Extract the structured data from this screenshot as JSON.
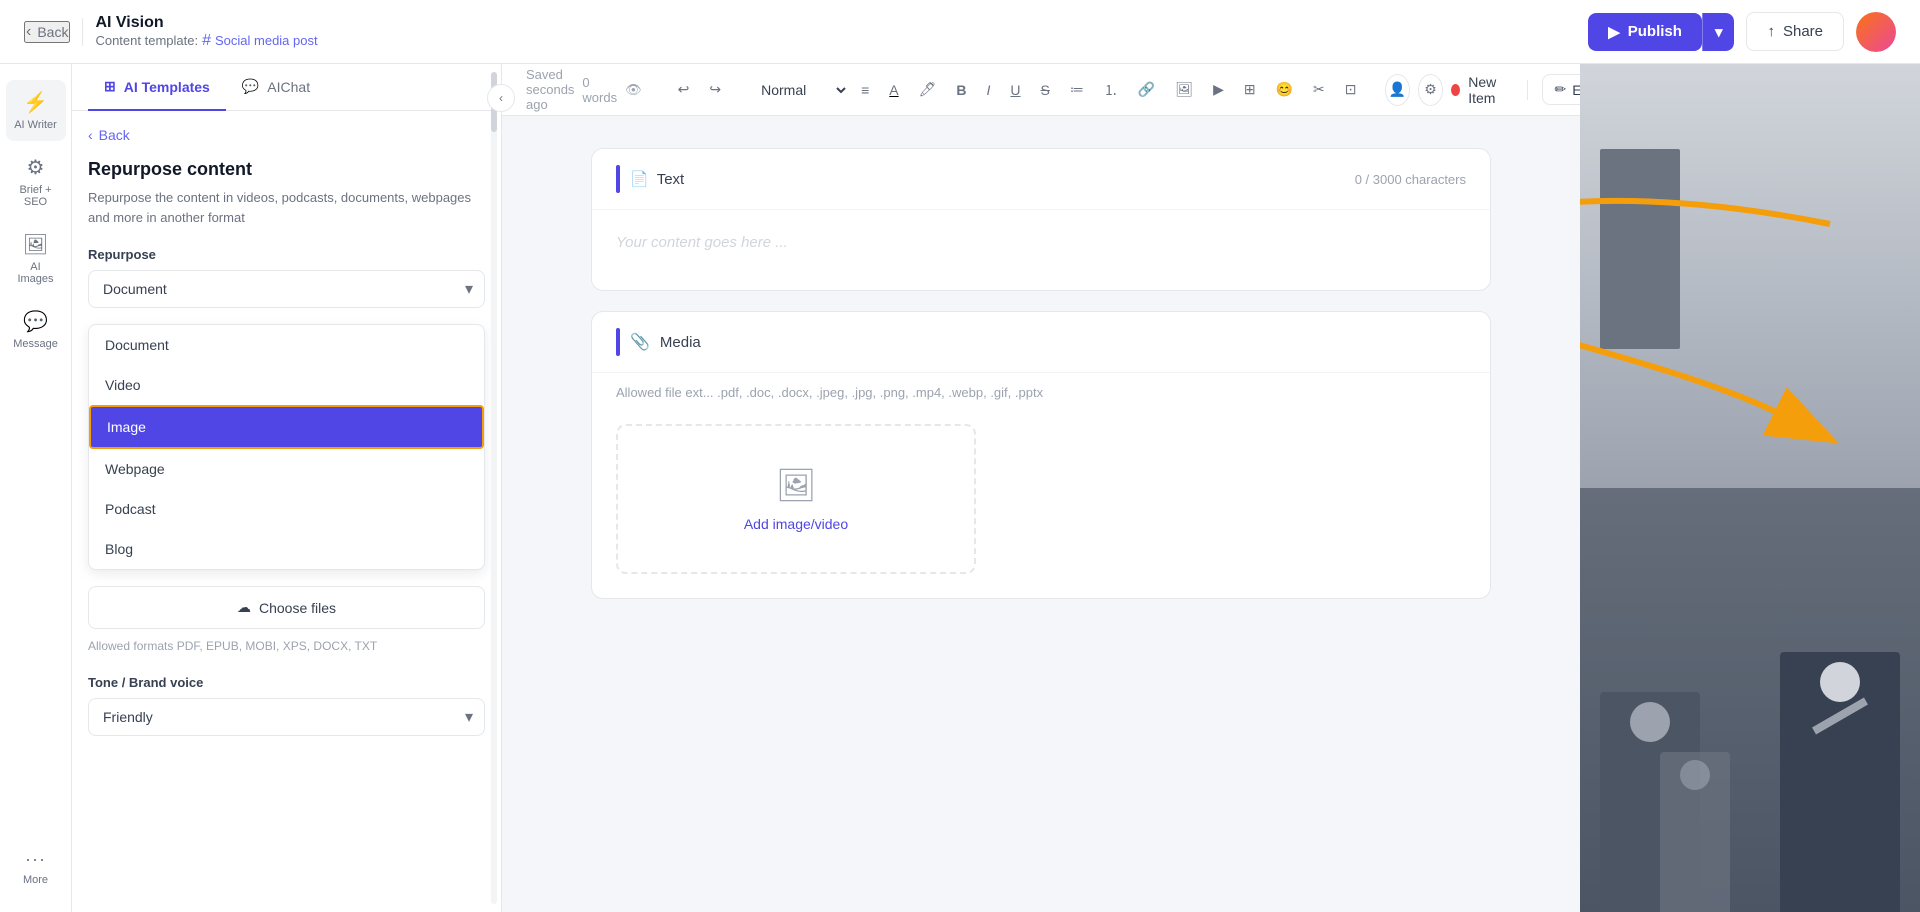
{
  "topbar": {
    "back_label": "Back",
    "app_title": "AI Vision",
    "template_prefix": "Content template:",
    "template_hash": "#",
    "template_name": "Social media post",
    "publish_label": "Publish",
    "share_label": "Share"
  },
  "sidebar": {
    "tabs": [
      {
        "id": "ai-templates",
        "label": "AI Templates",
        "icon": "⊞",
        "active": true
      },
      {
        "id": "aichat",
        "label": "AIChat",
        "icon": "💬",
        "active": false
      }
    ],
    "back_label": "Back",
    "section_title": "Repurpose content",
    "section_desc": "Repurpose the content in videos, podcasts, documents, webpages and more in another format",
    "repurpose_label": "Repurpose",
    "repurpose_value": "Document",
    "dropdown_items": [
      {
        "id": "document",
        "label": "Document",
        "selected": false
      },
      {
        "id": "video",
        "label": "Video",
        "selected": false
      },
      {
        "id": "image",
        "label": "Image",
        "selected": true
      },
      {
        "id": "webpage",
        "label": "Webpage",
        "selected": false
      },
      {
        "id": "podcast",
        "label": "Podcast",
        "selected": false
      },
      {
        "id": "blog",
        "label": "Blog",
        "selected": false
      }
    ],
    "choose_files_label": "Choose files",
    "choose_files_icon": "☁",
    "formats_text": "Allowed formats PDF, EPUB, MOBI, XPS, DOCX, TXT",
    "tone_label": "Tone / Brand voice",
    "tone_value": "Friendly"
  },
  "nav": {
    "items": [
      {
        "id": "ai-writer",
        "icon": "⚡",
        "label": "AI Writer",
        "active": true
      },
      {
        "id": "brief-seo",
        "icon": "⚙",
        "label": "Brief + SEO",
        "active": false
      },
      {
        "id": "ai-images",
        "icon": "🖼",
        "label": "AI Images",
        "active": false
      },
      {
        "id": "message",
        "icon": "💬",
        "label": "Message",
        "active": false
      },
      {
        "id": "more",
        "icon": "···",
        "label": "More",
        "active": false
      }
    ]
  },
  "toolbar": {
    "saved_status": "Saved seconds ago",
    "word_count": "0 words",
    "text_style": "Normal",
    "editing_label": "Editing",
    "new_item_label": "New Item",
    "undo_icon": "↩",
    "redo_icon": "↪"
  },
  "editor": {
    "sections": [
      {
        "id": "text",
        "name": "Text",
        "icon": "📄",
        "char_count": "0 / 3000 characters",
        "placeholder": "Your content goes here ..."
      }
    ],
    "media": {
      "title": "Media",
      "allowed_text": "Allowed file ext... .pdf, .doc, .docx, .jpeg, .jpg, .png, .mp4, .webp, .gif, .pptx",
      "add_media_label": "Add image/video"
    }
  }
}
